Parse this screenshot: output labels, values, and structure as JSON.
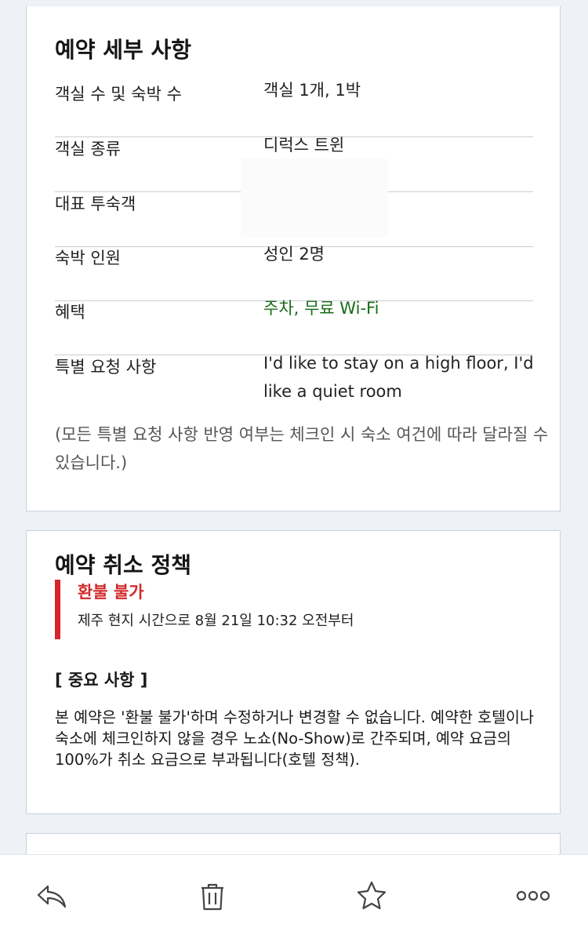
{
  "details": {
    "title": "예약 세부 사항",
    "rows": [
      {
        "label": "객실 수 및 숙박 수",
        "value": "객실 1개, 1박"
      },
      {
        "label": "객실 종류",
        "value": "디럭스 트윈"
      },
      {
        "label": "대표 투숙객",
        "value": ""
      },
      {
        "label": "숙박 인원",
        "value": "성인 2명"
      },
      {
        "label": "혜택",
        "value": "주차, 무료 Wi-Fi"
      },
      {
        "label": "특별 요청 사항",
        "value": "I'd like to stay on a high floor, I'd like a quiet room"
      }
    ],
    "note": "(모든 특별 요청 사항 반영 여부는 체크인 시 숙소 여건에 따라 달라질 수 있습니다.)"
  },
  "cancellation": {
    "title": "예약 취소 정책",
    "refund_label": "환불 불가",
    "refund_time": "제주 현지 시간으로 8월 21일 10:32 오전부터",
    "important_heading": "[ 중요 사항 ]",
    "important_body": "본 예약은 '환불 불가'하며 수정하거나 변경할 수 없습니다. 예약한 호텔이나 숙소에 체크인하지 않을 경우 노쇼(No-Show)로 간주되며, 예약 요금의 100%가 취소 요금으로 부과됩니다(호텔 정책).",
    "accent_color": "#d6262b"
  },
  "toolbar": {
    "icons": [
      "reply-icon",
      "trash-icon",
      "star-icon",
      "more-icon"
    ]
  },
  "colors": {
    "benefit_text": "#1a6b1a",
    "background": "#eef1f6"
  }
}
